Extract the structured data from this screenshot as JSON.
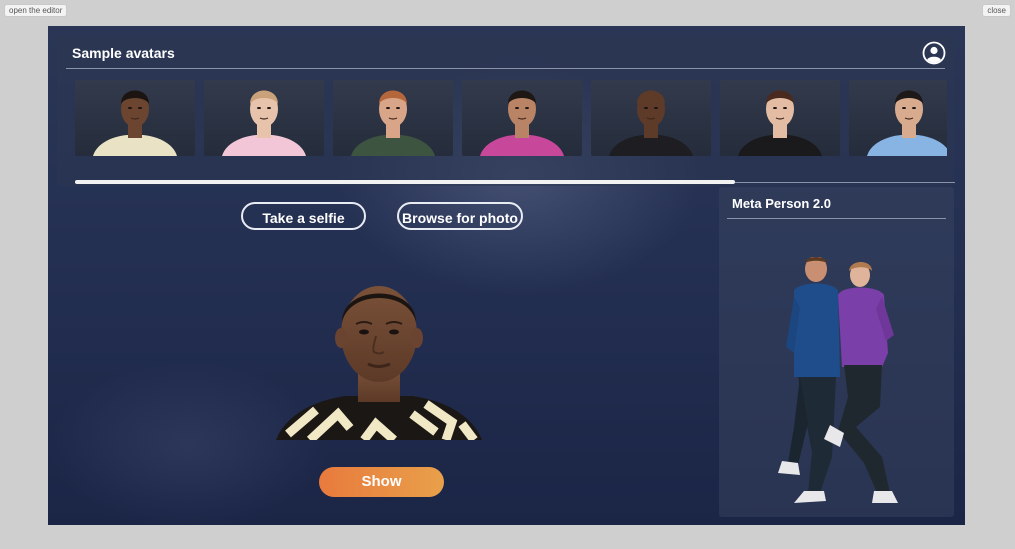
{
  "chrome": {
    "open_editor_label": "open the editor",
    "close_label": "close"
  },
  "sample_panel": {
    "title": "Sample avatars",
    "profile_icon": "user-circle-icon",
    "scroll_fraction": 0.75,
    "avatars": [
      {
        "icon": "avatar-young-man-patterned-shirt",
        "skin": "#6b4530",
        "hair": "#1b1411",
        "shirt": "#e9e2c4"
      },
      {
        "icon": "avatar-blonde-woman-pink-top",
        "skin": "#e8c3ac",
        "hair": "#c9a17a",
        "shirt": "#f2c6d6"
      },
      {
        "icon": "avatar-redhead-man-green-shirt",
        "skin": "#d9a588",
        "hair": "#b4673a",
        "shirt": "#3d5440"
      },
      {
        "icon": "avatar-woman-colorful-top",
        "skin": "#b98366",
        "hair": "#1e1714",
        "shirt": "#c7479a"
      },
      {
        "icon": "avatar-bald-man-suit",
        "skin": "#5e3b28",
        "hair": "#5e3b28",
        "shirt": "#1e1e22"
      },
      {
        "icon": "avatar-woman-black-blazer",
        "skin": "#e4bca3",
        "hair": "#4a2a1f",
        "shirt": "#1a1a1d"
      },
      {
        "icon": "avatar-man-blue-shirt",
        "skin": "#d8ab8f",
        "hair": "#1d1918",
        "shirt": "#88b4e4"
      }
    ]
  },
  "actions": {
    "take_selfie_label": "Take a selfie",
    "browse_label": "Browse for photo",
    "show_label": "Show"
  },
  "preview": {
    "icon": "selected-avatar-preview"
  },
  "meta_panel": {
    "title": "Meta Person 2.0",
    "icon": "meta-person-full-body-figures"
  },
  "colors": {
    "accent_gradient_start": "#e87a3d",
    "accent_gradient_end": "#e9a04a",
    "background": "#243052"
  }
}
